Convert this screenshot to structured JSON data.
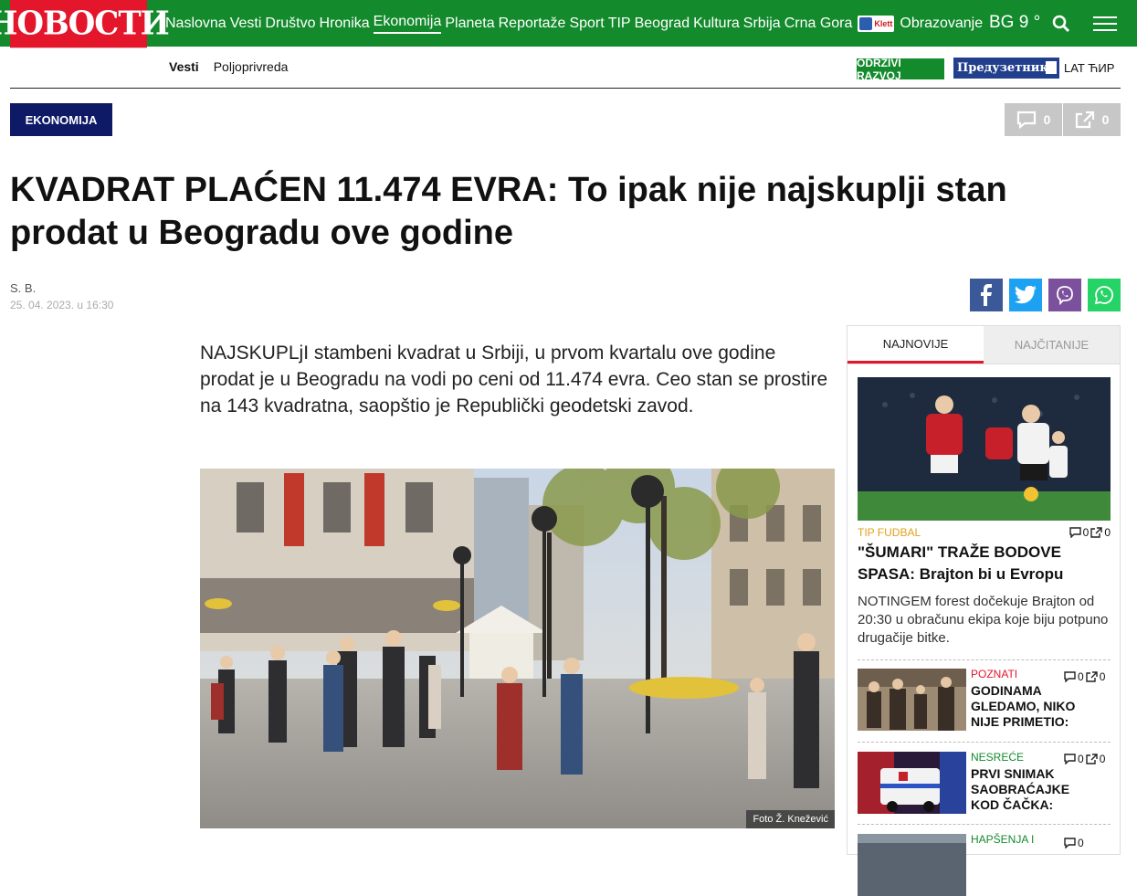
{
  "brand": {
    "logo": "НОВОСТИ"
  },
  "nav": {
    "items": [
      "Naslovna",
      "Vesti",
      "Društvo",
      "Hronika",
      "Ekonomija",
      "Planeta",
      "Reportaže",
      "Sport",
      "TIP",
      "Beograd",
      "Kultura",
      "Srbija",
      "Crna Gora"
    ],
    "klett": "Klett",
    "last": "Obrazovanje",
    "weather": "BG 9 °"
  },
  "subnav": {
    "items": [
      "Vesti",
      "Poljoprivreda"
    ]
  },
  "partners": {
    "odrzivi": "ODRŽIVI RAZVOJ",
    "preduzetnik": "Предузетник",
    "lang": "LAT ЋИР"
  },
  "article": {
    "category": "EKONOMIJA",
    "comments": "0",
    "shares": "0",
    "title": "KVADRAT PLAĆEN 11.474 EVRA: To ipak nije najskuplji stan prodat u Beogradu ove godine",
    "author": "S. B.",
    "date": "25. 04. 2023. u 16:30",
    "lead": "NAJSKUPLjI stambeni kvadrat u Srbiji, u prvom kvartalu ove godine prodat je u Beogradu na vodi po ceni od 11.474 evra. Ceo stan se prostire na 143 kvadratna, saopštio je Republički geodetski zavod.",
    "photo_caption": "Foto Ž. Knežević"
  },
  "colors": {
    "green": "#138a2c",
    "red": "#e3162c",
    "navy": "#0e1a66",
    "facebook": "#3b5998",
    "twitter": "#1da1f2",
    "viber": "#7b519d",
    "whatsapp": "#25d366"
  },
  "sidebar": {
    "tabs": [
      "NAJNOVIJE",
      "NAJČITANIJE"
    ],
    "featured": {
      "kicker": "TIP FUDBAL",
      "comments": "0",
      "shares": "0",
      "title": "\"ŠUMARI\" TRAŽE BODOVE SPASA: Brajton bi u Evropu",
      "summary": "NOTINGEM forest dočekuje Brajton od 20:30 u obračunu ekipa koje biju potpuno drugačije bitke."
    },
    "items": [
      {
        "kicker": "POZNATI",
        "title": "GODINAMA GLEDAMO, NIKO NIJE PRIMETIO:",
        "comments": "0",
        "shares": "0"
      },
      {
        "kicker": "NESREĆE",
        "title": "PRVI SNIMAK SAOBRAĆAJKE KOD ČAČKA:",
        "comments": "0",
        "shares": "0"
      },
      {
        "kicker": "HAPŠENJA I",
        "title": "",
        "comments": "0",
        "shares": "0"
      }
    ]
  }
}
